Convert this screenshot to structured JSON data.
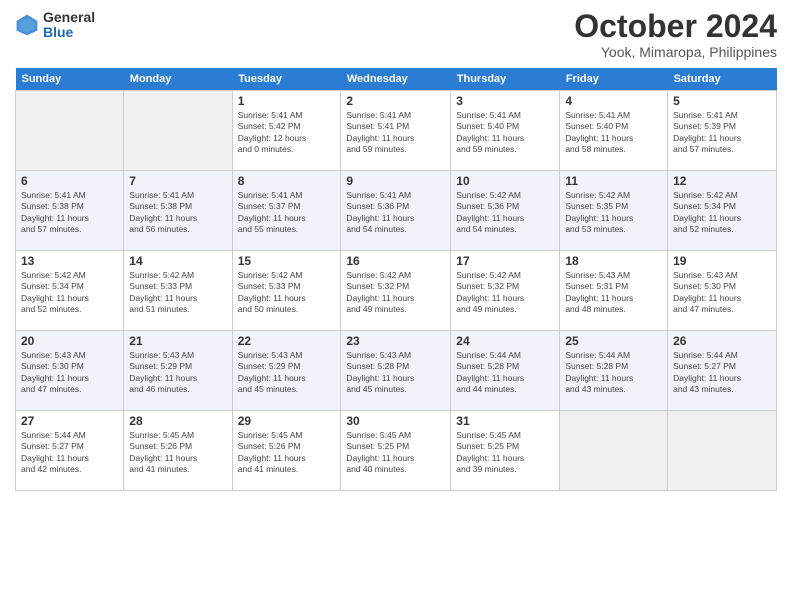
{
  "header": {
    "logo_general": "General",
    "logo_blue": "Blue",
    "month_title": "October 2024",
    "location": "Yook, Mimaropa, Philippines"
  },
  "weekdays": [
    "Sunday",
    "Monday",
    "Tuesday",
    "Wednesday",
    "Thursday",
    "Friday",
    "Saturday"
  ],
  "weeks": [
    [
      {
        "day": "",
        "info": ""
      },
      {
        "day": "",
        "info": ""
      },
      {
        "day": "1",
        "info": "Sunrise: 5:41 AM\nSunset: 5:42 PM\nDaylight: 12 hours\nand 0 minutes."
      },
      {
        "day": "2",
        "info": "Sunrise: 5:41 AM\nSunset: 5:41 PM\nDaylight: 11 hours\nand 59 minutes."
      },
      {
        "day": "3",
        "info": "Sunrise: 5:41 AM\nSunset: 5:40 PM\nDaylight: 11 hours\nand 59 minutes."
      },
      {
        "day": "4",
        "info": "Sunrise: 5:41 AM\nSunset: 5:40 PM\nDaylight: 11 hours\nand 58 minutes."
      },
      {
        "day": "5",
        "info": "Sunrise: 5:41 AM\nSunset: 5:39 PM\nDaylight: 11 hours\nand 57 minutes."
      }
    ],
    [
      {
        "day": "6",
        "info": "Sunrise: 5:41 AM\nSunset: 5:38 PM\nDaylight: 11 hours\nand 57 minutes."
      },
      {
        "day": "7",
        "info": "Sunrise: 5:41 AM\nSunset: 5:38 PM\nDaylight: 11 hours\nand 56 minutes."
      },
      {
        "day": "8",
        "info": "Sunrise: 5:41 AM\nSunset: 5:37 PM\nDaylight: 11 hours\nand 55 minutes."
      },
      {
        "day": "9",
        "info": "Sunrise: 5:41 AM\nSunset: 5:36 PM\nDaylight: 11 hours\nand 54 minutes."
      },
      {
        "day": "10",
        "info": "Sunrise: 5:42 AM\nSunset: 5:36 PM\nDaylight: 11 hours\nand 54 minutes."
      },
      {
        "day": "11",
        "info": "Sunrise: 5:42 AM\nSunset: 5:35 PM\nDaylight: 11 hours\nand 53 minutes."
      },
      {
        "day": "12",
        "info": "Sunrise: 5:42 AM\nSunset: 5:34 PM\nDaylight: 11 hours\nand 52 minutes."
      }
    ],
    [
      {
        "day": "13",
        "info": "Sunrise: 5:42 AM\nSunset: 5:34 PM\nDaylight: 11 hours\nand 52 minutes."
      },
      {
        "day": "14",
        "info": "Sunrise: 5:42 AM\nSunset: 5:33 PM\nDaylight: 11 hours\nand 51 minutes."
      },
      {
        "day": "15",
        "info": "Sunrise: 5:42 AM\nSunset: 5:33 PM\nDaylight: 11 hours\nand 50 minutes."
      },
      {
        "day": "16",
        "info": "Sunrise: 5:42 AM\nSunset: 5:32 PM\nDaylight: 11 hours\nand 49 minutes."
      },
      {
        "day": "17",
        "info": "Sunrise: 5:42 AM\nSunset: 5:32 PM\nDaylight: 11 hours\nand 49 minutes."
      },
      {
        "day": "18",
        "info": "Sunrise: 5:43 AM\nSunset: 5:31 PM\nDaylight: 11 hours\nand 48 minutes."
      },
      {
        "day": "19",
        "info": "Sunrise: 5:43 AM\nSunset: 5:30 PM\nDaylight: 11 hours\nand 47 minutes."
      }
    ],
    [
      {
        "day": "20",
        "info": "Sunrise: 5:43 AM\nSunset: 5:30 PM\nDaylight: 11 hours\nand 47 minutes."
      },
      {
        "day": "21",
        "info": "Sunrise: 5:43 AM\nSunset: 5:29 PM\nDaylight: 11 hours\nand 46 minutes."
      },
      {
        "day": "22",
        "info": "Sunrise: 5:43 AM\nSunset: 5:29 PM\nDaylight: 11 hours\nand 45 minutes."
      },
      {
        "day": "23",
        "info": "Sunrise: 5:43 AM\nSunset: 5:28 PM\nDaylight: 11 hours\nand 45 minutes."
      },
      {
        "day": "24",
        "info": "Sunrise: 5:44 AM\nSunset: 5:28 PM\nDaylight: 11 hours\nand 44 minutes."
      },
      {
        "day": "25",
        "info": "Sunrise: 5:44 AM\nSunset: 5:28 PM\nDaylight: 11 hours\nand 43 minutes."
      },
      {
        "day": "26",
        "info": "Sunrise: 5:44 AM\nSunset: 5:27 PM\nDaylight: 11 hours\nand 43 minutes."
      }
    ],
    [
      {
        "day": "27",
        "info": "Sunrise: 5:44 AM\nSunset: 5:27 PM\nDaylight: 11 hours\nand 42 minutes."
      },
      {
        "day": "28",
        "info": "Sunrise: 5:45 AM\nSunset: 5:26 PM\nDaylight: 11 hours\nand 41 minutes."
      },
      {
        "day": "29",
        "info": "Sunrise: 5:45 AM\nSunset: 5:26 PM\nDaylight: 11 hours\nand 41 minutes."
      },
      {
        "day": "30",
        "info": "Sunrise: 5:45 AM\nSunset: 5:25 PM\nDaylight: 11 hours\nand 40 minutes."
      },
      {
        "day": "31",
        "info": "Sunrise: 5:45 AM\nSunset: 5:25 PM\nDaylight: 11 hours\nand 39 minutes."
      },
      {
        "day": "",
        "info": ""
      },
      {
        "day": "",
        "info": ""
      }
    ]
  ]
}
